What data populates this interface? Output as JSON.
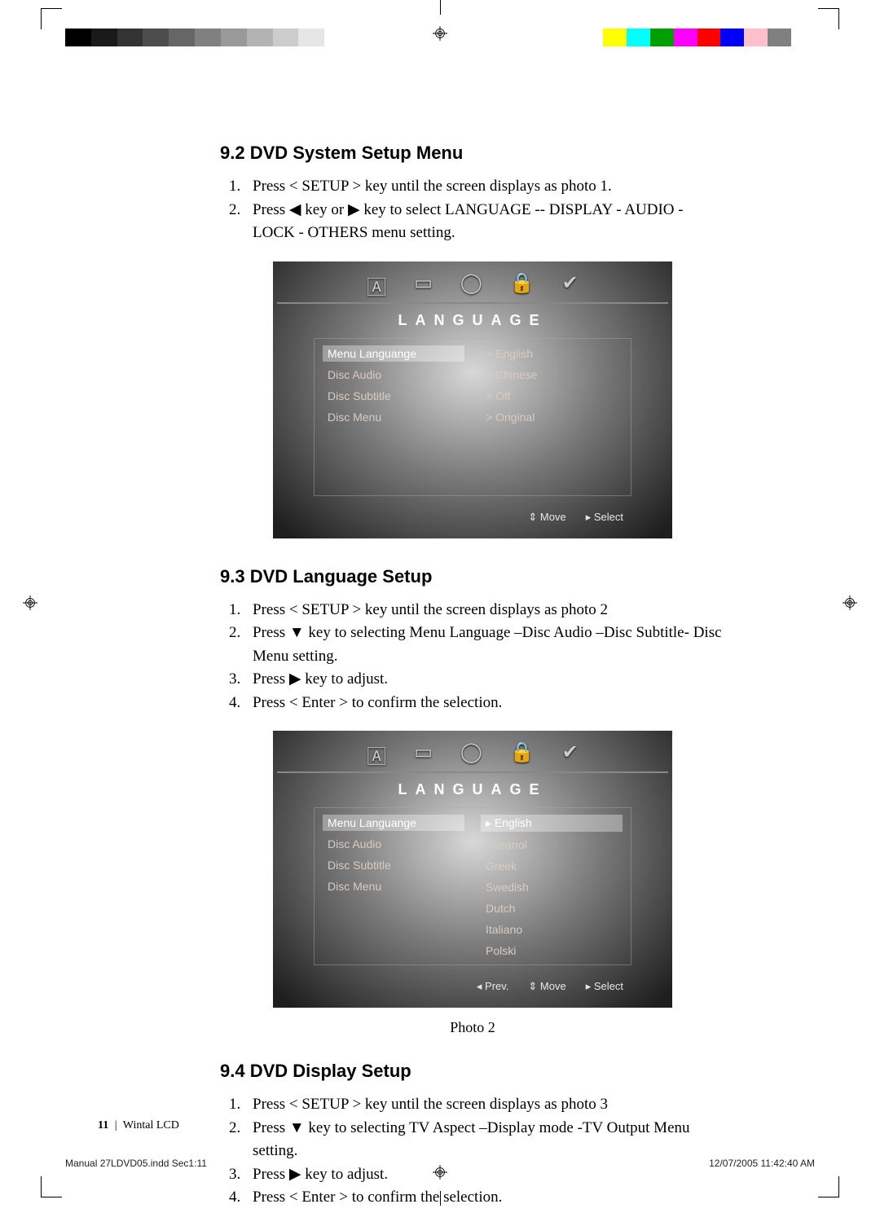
{
  "sections": {
    "s1": {
      "heading": "9.2 DVD System Setup Menu",
      "items": [
        "Press < SETUP > key until the screen displays as photo 1.",
        "Press ◀ key or ▶ key to select LANGUAGE -- DISPLAY - AUDIO - LOCK - OTHERS menu setting."
      ]
    },
    "s2": {
      "heading": "9.3 DVD  Language Setup",
      "items": [
        "Press < SETUP > key until the screen displays as photo 2",
        "Press ▼ key to selecting Menu Language –Disc Audio –Disc Subtitle- Disc Menu setting.",
        "Press ▶ key to adjust.",
        "Press < Enter > to confirm the selection."
      ]
    },
    "s3": {
      "heading": "9.4 DVD Display Setup",
      "items": [
        "Press < SETUP > key until the screen displays as photo 3",
        "Press ▼ key to selecting TV Aspect –Display mode -TV Output Menu setting.",
        "Press ▶ key to adjust.",
        "Press < Enter > to confirm the selection."
      ]
    }
  },
  "osd1": {
    "title": "LANGUAGE",
    "left": [
      "Menu Languange",
      "Disc Audio",
      "Disc Subtitle",
      "Disc Menu"
    ],
    "right": [
      "> English",
      "> Chinese",
      "> Off",
      "> Original"
    ],
    "footer": [
      "⇕ Move",
      "▸ Select"
    ]
  },
  "osd2": {
    "title": "LANGUAGE",
    "left": [
      "Menu Languange",
      "Disc Audio",
      "Disc Subtitle",
      "Disc Menu"
    ],
    "right": [
      "▸ English",
      "Espanol",
      "Greek",
      "Swedish",
      "Dutch",
      "Italiano",
      "Polski"
    ],
    "footer": [
      "◂ Prev.",
      "⇕ Move",
      "▸ Select"
    ],
    "caption": "Photo 2"
  },
  "footer": {
    "page": "11",
    "label": "Wintal LCD"
  },
  "indd": {
    "file": "Manual 27LDVD05.indd   Sec1:11",
    "stamp": "12/07/2005   11:42:40 AM"
  },
  "colorbar_left": [
    "#000",
    "#1a1a1a",
    "#333",
    "#4d4d4d",
    "#666",
    "#808080",
    "#999",
    "#b3b3b3",
    "#ccc",
    "#e6e6e6",
    "#fff"
  ],
  "colorbar_right": [
    "#ffff00",
    "#00ffff",
    "#00a000",
    "#ff00ff",
    "#ff0000",
    "#0000ff",
    "#ffc0cb",
    "#808080",
    "#fff"
  ]
}
